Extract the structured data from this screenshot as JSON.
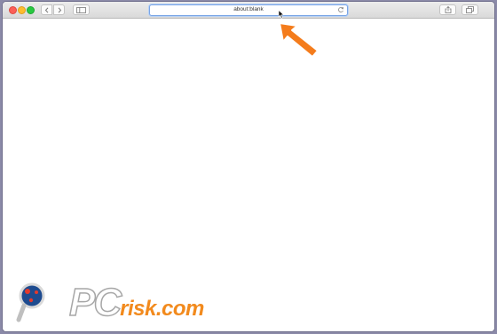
{
  "browser": {
    "address_bar": {
      "url": "about:blank"
    },
    "icons": {
      "back": "chevron-left-icon",
      "forward": "chevron-right-icon",
      "sidebar": "sidebar-icon",
      "reload": "reload-icon",
      "share": "share-icon",
      "tabs": "tabs-icon"
    }
  },
  "annotation": {
    "arrow_color": "#f47c1c"
  },
  "watermark": {
    "prefix": "PC",
    "suffix": "risk.com",
    "accent_color": "#f28a1d"
  }
}
